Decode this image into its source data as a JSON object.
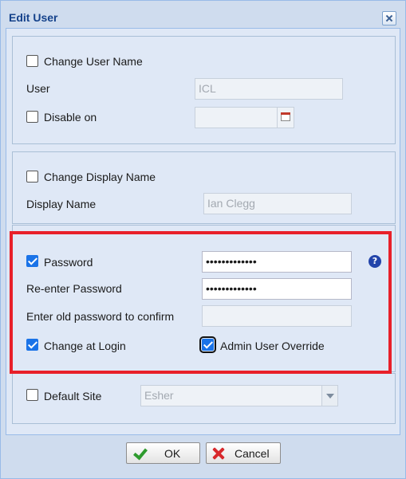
{
  "window": {
    "title": "Edit User"
  },
  "user_section": {
    "change_user_name_label": "Change User Name",
    "change_user_name_checked": false,
    "user_label": "User",
    "user_value": "ICL",
    "disable_on_label": "Disable on",
    "disable_on_checked": false,
    "disable_on_value": ""
  },
  "display_section": {
    "change_display_name_label": "Change Display Name",
    "change_display_name_checked": false,
    "display_name_label": "Display Name",
    "display_name_value": "Ian Clegg"
  },
  "password_section": {
    "password_label": "Password",
    "password_checked": true,
    "password_value": "•••••••••••••",
    "reenter_label": "Re-enter Password",
    "reenter_value": "•••••••••••••",
    "old_password_label": "Enter old password to confirm",
    "old_password_value": "",
    "change_at_login_label": "Change at Login",
    "change_at_login_checked": true,
    "admin_override_label": "Admin User Override",
    "admin_override_checked": true,
    "help_icon": "?"
  },
  "site_section": {
    "default_site_label": "Default Site",
    "default_site_checked": false,
    "default_site_value": "Esher"
  },
  "buttons": {
    "ok_label": "OK",
    "cancel_label": "Cancel"
  },
  "colors": {
    "highlight": "#e8202a",
    "title_text": "#15428b",
    "checkbox_checked": "#1a73e8"
  }
}
